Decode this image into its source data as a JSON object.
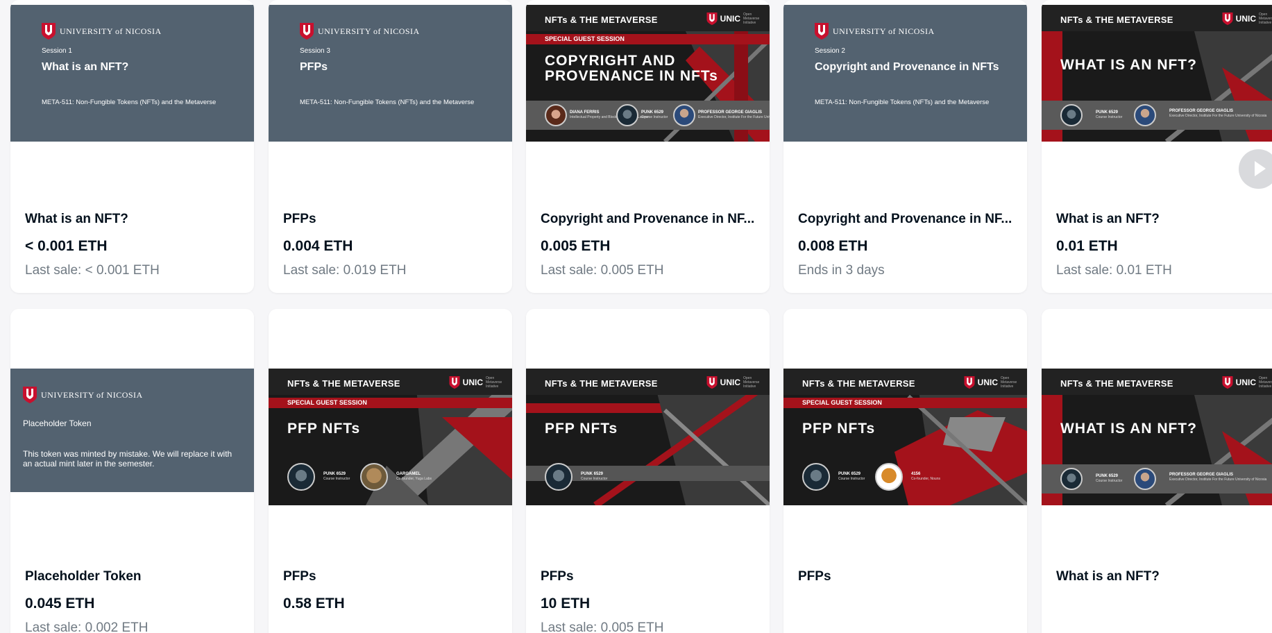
{
  "university_name": "UNIVERSITY of NICOSIA",
  "course_line": "META-511: Non-Fungible Tokens (NFTs) and the Metaverse",
  "slide_header": "NFTs & THE METAVERSE",
  "unic": "UNIC",
  "unic_sub": "Open Metaverse Initiative",
  "guest_badge": "SPECIAL GUEST SESSION",
  "people": {
    "punk": "PUNK 6529",
    "punk_role": "Course Instructor",
    "prof": "PROFESSOR GEORGE GIAGLIS",
    "prof_role": "Executive Director, Institute For the Future University of Nicosia",
    "diana": "DIANA FERRIS",
    "diana_role": "Intellectual Property and Blockchain / Web3 Lawyer",
    "gargamel": "GARGAMEL",
    "gargamel_role": "Co-founder, Yuga Labs",
    "4156": "4156",
    "4156_role": "Co-founder, Nouns"
  },
  "cards": [
    {
      "title": "What is an NFT?",
      "price": "< 0.001 ETH",
      "sub": "Last sale: < 0.001 ETH",
      "slide_session": "Session 1",
      "slide_title": "What is an NFT?"
    },
    {
      "title": "PFPs",
      "price": "0.004 ETH",
      "sub": "Last sale: 0.019 ETH",
      "slide_session": "Session 3",
      "slide_title": "PFPs"
    },
    {
      "title": "Copyright and Provenance in NF...",
      "price": "0.005 ETH",
      "sub": "Last sale: 0.005 ETH",
      "slide_title_line1": "COPYRIGHT AND",
      "slide_title_line2": "PROVENANCE IN NFTs"
    },
    {
      "title": "Copyright and Provenance in NF...",
      "price": "0.008 ETH",
      "sub": "Ends in 3 days",
      "slide_session": "Session 2",
      "slide_title": "Copyright and Provenance in NFTs"
    },
    {
      "title": "What is an NFT?",
      "price": "0.01 ETH",
      "sub": "Last sale: 0.01 ETH",
      "slide_title": "WHAT IS AN NFT?"
    },
    {
      "title": "Placeholder Token",
      "price": "0.045 ETH",
      "sub": "Last sale: 0.002 ETH",
      "slide_title": "Placeholder Token",
      "slide_body": "This token was minted by mistake.  We will replace it with an actual mint later in the semester."
    },
    {
      "title": "PFPs",
      "price": "0.58 ETH",
      "sub": "",
      "slide_title": "PFP NFTs"
    },
    {
      "title": "PFPs",
      "price": "10 ETH",
      "sub": "Last sale: 0.005 ETH",
      "slide_title": "PFP NFTs"
    },
    {
      "title": "PFPs",
      "price": "",
      "sub": "",
      "slide_title": "PFP NFTs"
    },
    {
      "title": "What is an NFT?",
      "price": "",
      "sub": "",
      "slide_title": "WHAT IS AN NFT?"
    }
  ],
  "colors": {
    "slide_gray": "#536270",
    "unic_red": "#a4121b",
    "text_dark": "#04111d",
    "text_muted": "#707a83"
  }
}
